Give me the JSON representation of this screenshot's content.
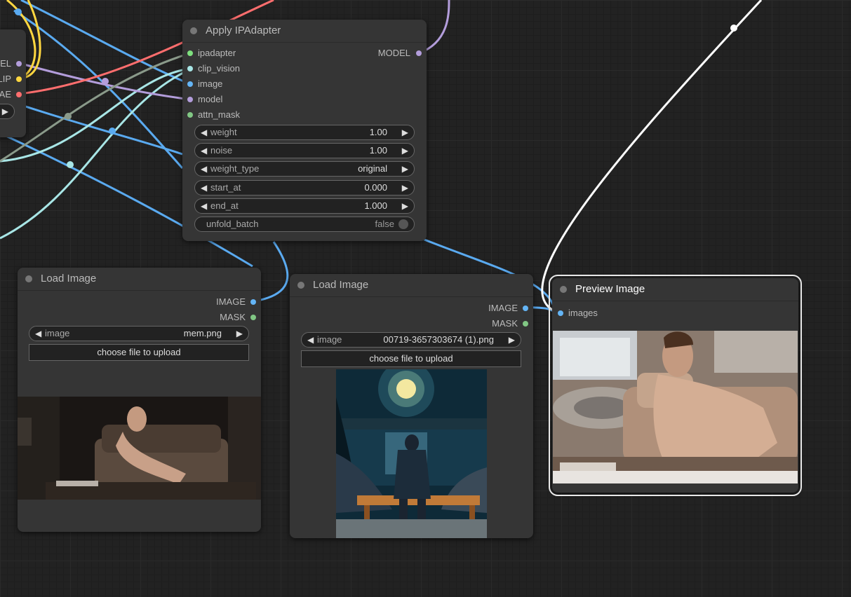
{
  "left_partial_node": {
    "outputs": [
      "EL",
      "LIP",
      "AE"
    ],
    "output_colors": [
      "#b39ddb",
      "#ffd740",
      "#ff6e6e"
    ]
  },
  "apply_ipadapter": {
    "title": "Apply IPAdapter",
    "inputs": [
      {
        "label": "ipadapter",
        "color": "#7ee07e"
      },
      {
        "label": "clip_vision",
        "color": "#a8e6e6"
      },
      {
        "label": "image",
        "color": "#64b5f6"
      },
      {
        "label": "model",
        "color": "#b39ddb"
      },
      {
        "label": "attn_mask",
        "color": "#81c784"
      }
    ],
    "output": {
      "label": "MODEL",
      "color": "#b39ddb"
    },
    "widgets": [
      {
        "label": "weight",
        "value": "1.00"
      },
      {
        "label": "noise",
        "value": "1.00"
      },
      {
        "label": "weight_type",
        "value": "original"
      },
      {
        "label": "start_at",
        "value": "0.000"
      },
      {
        "label": "end_at",
        "value": "1.000"
      }
    ],
    "toggle": {
      "label": "unfold_batch",
      "value": "false"
    }
  },
  "load_image_1": {
    "title": "Load Image",
    "outputs": [
      {
        "label": "IMAGE",
        "color": "#64b5f6"
      },
      {
        "label": "MASK",
        "color": "#81c784"
      }
    ],
    "image_widget": {
      "label": "image",
      "value": "mem.png"
    },
    "upload_label": "choose file to upload"
  },
  "load_image_2": {
    "title": "Load Image",
    "outputs": [
      {
        "label": "IMAGE",
        "color": "#64b5f6"
      },
      {
        "label": "MASK",
        "color": "#81c784"
      }
    ],
    "image_widget": {
      "label": "image",
      "value": "00719-3657303674 (1).png"
    },
    "upload_label": "choose file to upload"
  },
  "preview_image": {
    "title": "Preview Image",
    "input": {
      "label": "images",
      "color": "#64b5f6"
    }
  },
  "icons": {
    "left_arrow": "◀",
    "right_arrow": "▶"
  },
  "colors": {
    "link_image": "#5aaaf0",
    "link_clip_vision": "#a8e6e6",
    "link_model": "#b39ddb",
    "link_clip": "#ffd740",
    "link_vae": "#ff6e6e",
    "link_selected": "#ffffff"
  }
}
